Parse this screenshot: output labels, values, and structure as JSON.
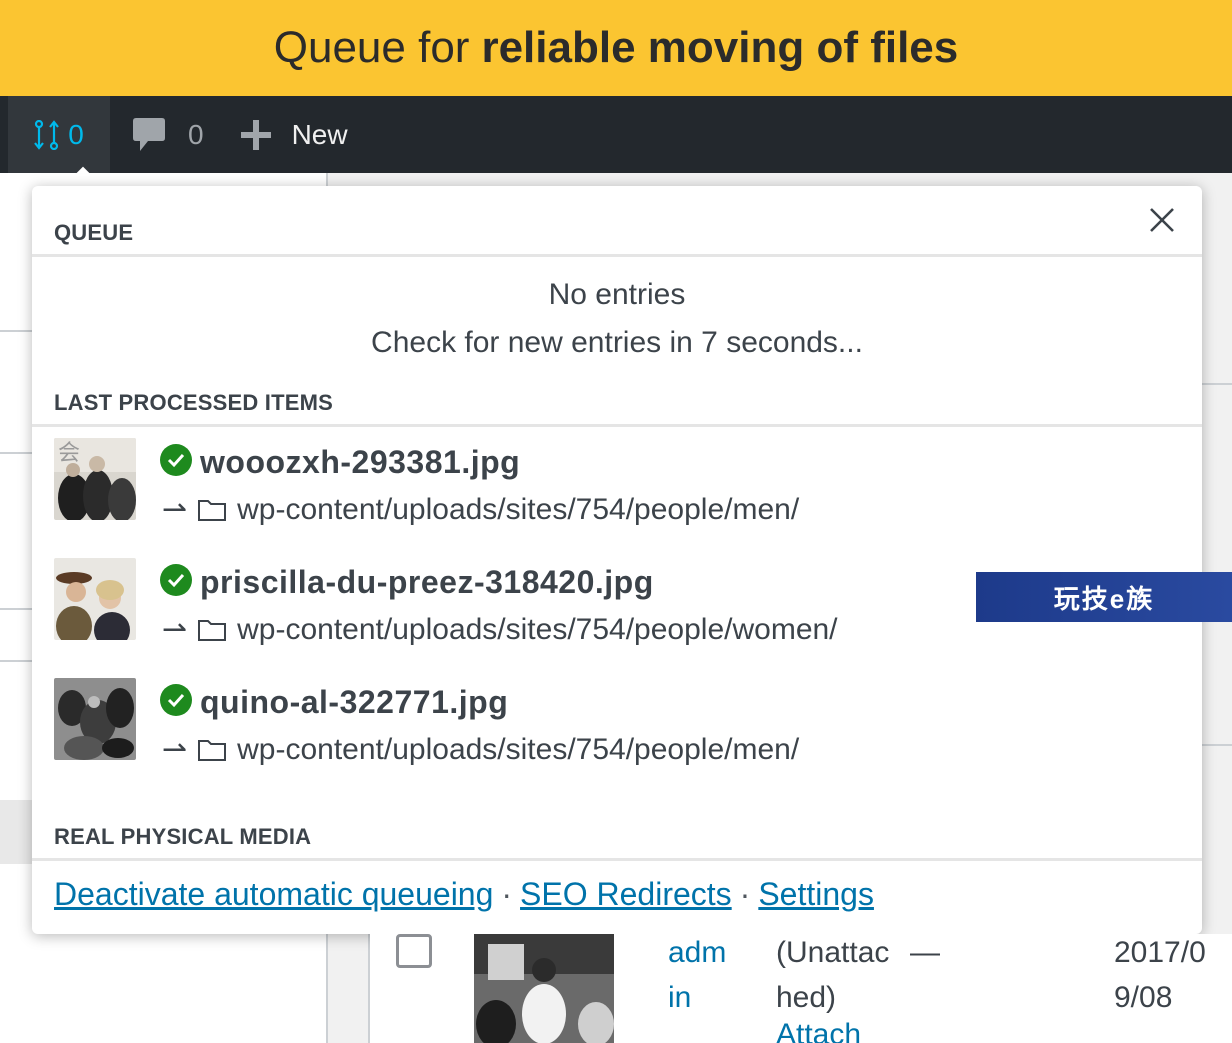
{
  "banner": {
    "normal": "Queue for",
    "bold": "reliable moving of files"
  },
  "adminbar": {
    "queue_count": "0",
    "comments_count": "0",
    "new_label": "New",
    "accent": "#00b9eb"
  },
  "popover": {
    "queue_title": "QUEUE",
    "empty_message": "No entries",
    "check_message": "Check for new entries in 7 seconds...",
    "last_processed_title": "LAST PROCESSED ITEMS",
    "items": [
      {
        "name": "wooozxh-293381.jpg",
        "arrow": "⇀",
        "path": "wp-content/uploads/sites/754/people/men/"
      },
      {
        "name": "priscilla-du-preez-318420.jpg",
        "arrow": "⇀",
        "path": "wp-content/uploads/sites/754/people/women/"
      },
      {
        "name": "quino-al-322771.jpg",
        "arrow": "⇀",
        "path": "wp-content/uploads/sites/754/people/men/"
      }
    ],
    "brand_title": "REAL PHYSICAL MEDIA",
    "footer": {
      "deactivate": "Deactivate automatic queueing",
      "seo": "SEO Redirects",
      "settings": "Settings",
      "sep": "·"
    },
    "status_color": "#1e8a1e"
  },
  "watermark": "玩技e族",
  "table_row": {
    "author_line1": "adm",
    "author_line2": "in",
    "attached_line1": "(Unattac",
    "attached_line2": "hed)",
    "attach_link": "Attach",
    "dash": "—",
    "date_line1": "2017/0",
    "date_line2": "9/08"
  }
}
